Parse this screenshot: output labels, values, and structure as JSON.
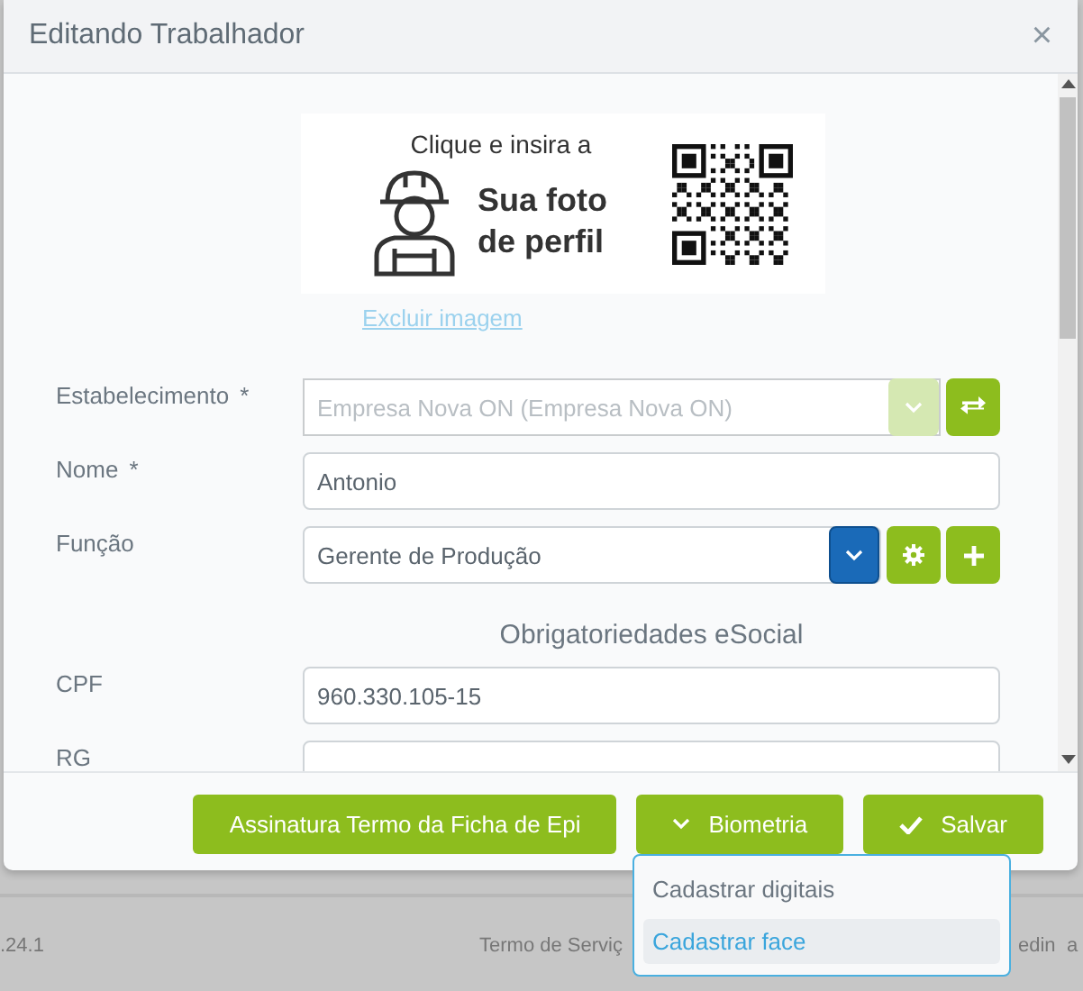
{
  "dialog": {
    "title": "Editando Trabalhador",
    "close": "×",
    "photo": {
      "prompt": "Clique e insira a",
      "caption": "Sua foto de perfil"
    },
    "delete_link": "Excluir imagem",
    "required_mark": "*",
    "fields": [
      {
        "kind": "locked-select",
        "label": "Estabelecimento",
        "required": true,
        "value": "Empresa Nova ON (Empresa Nova ON)",
        "disabled": true
      },
      {
        "kind": "text",
        "label": "Nome",
        "required": true,
        "value": "Antonio"
      },
      {
        "kind": "select-actions",
        "label": "Função",
        "required": false,
        "value": "Gerente de Produção"
      },
      {
        "kind": "heading",
        "title": "Obrigatoriedades eSocial"
      },
      {
        "kind": "text",
        "label": "CPF",
        "required": false,
        "value": "960.330.105-15"
      },
      {
        "kind": "text",
        "label": "RG",
        "required": false
      }
    ],
    "buttons": [
      {
        "kind": "plain",
        "label": "Assinatura Termo da Ficha de Epi"
      },
      {
        "kind": "dropdown",
        "label": "Biometria"
      },
      {
        "kind": "confirm",
        "label": "Salvar"
      }
    ],
    "menu": [
      {
        "label": "Cadastrar digitais",
        "selected": false
      },
      {
        "label": "Cadastrar face",
        "selected": true
      }
    ]
  },
  "page_footer": {
    "version": ".24.1",
    "links": [
      "Termo de Serviç",
      "edin",
      "a"
    ]
  }
}
